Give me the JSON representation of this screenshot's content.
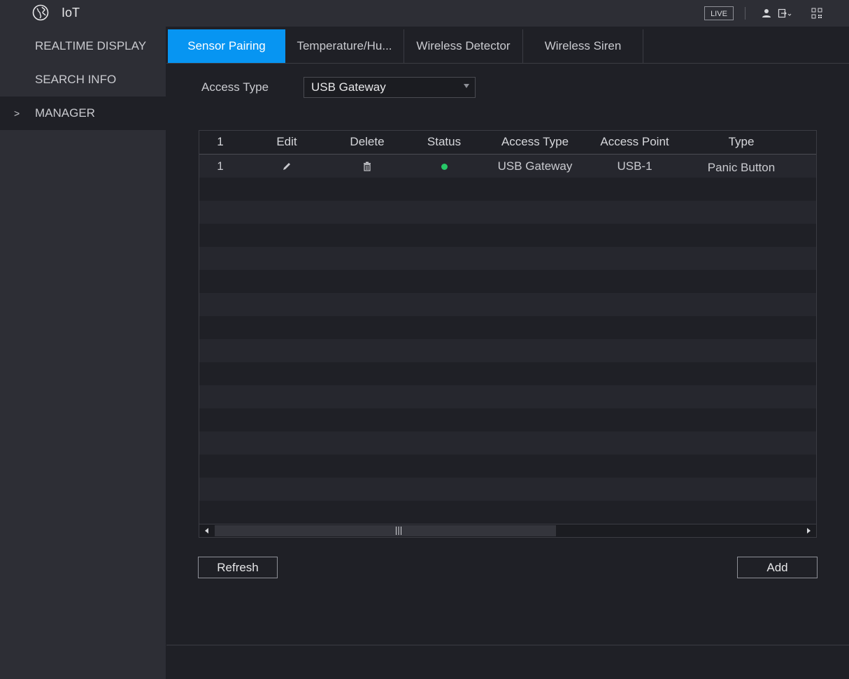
{
  "app": {
    "title": "IoT",
    "logo_icon": "globe-icon"
  },
  "topbar": {
    "live_label": "LIVE",
    "icons": [
      "user-icon",
      "logout-icon",
      "qr-code-icon"
    ]
  },
  "sidebar": {
    "items": [
      {
        "label": "REALTIME DISPLAY"
      },
      {
        "label": "SEARCH INFO"
      },
      {
        "label": "MANAGER",
        "chevron": ">"
      }
    ]
  },
  "tabs": [
    {
      "label": "Sensor Pairing"
    },
    {
      "label": "Temperature/Hu..."
    },
    {
      "label": "Wireless Detector"
    },
    {
      "label": "Wireless Siren"
    }
  ],
  "access_type": {
    "label": "Access Type",
    "value": "USB Gateway"
  },
  "table": {
    "headers": [
      "1",
      "Edit",
      "Delete",
      "Status",
      "Access Type",
      "Access Point",
      "Type"
    ],
    "rows": [
      {
        "index": "1",
        "edit_icon": "pencil-icon",
        "delete_icon": "trash-icon",
        "status": "online",
        "access_type": "USB Gateway",
        "access_point": "USB-1",
        "type": "Panic Button"
      }
    ]
  },
  "buttons": {
    "refresh": "Refresh",
    "add": "Add"
  },
  "colors": {
    "accent": "#0795f2",
    "status_online": "#27c968"
  }
}
